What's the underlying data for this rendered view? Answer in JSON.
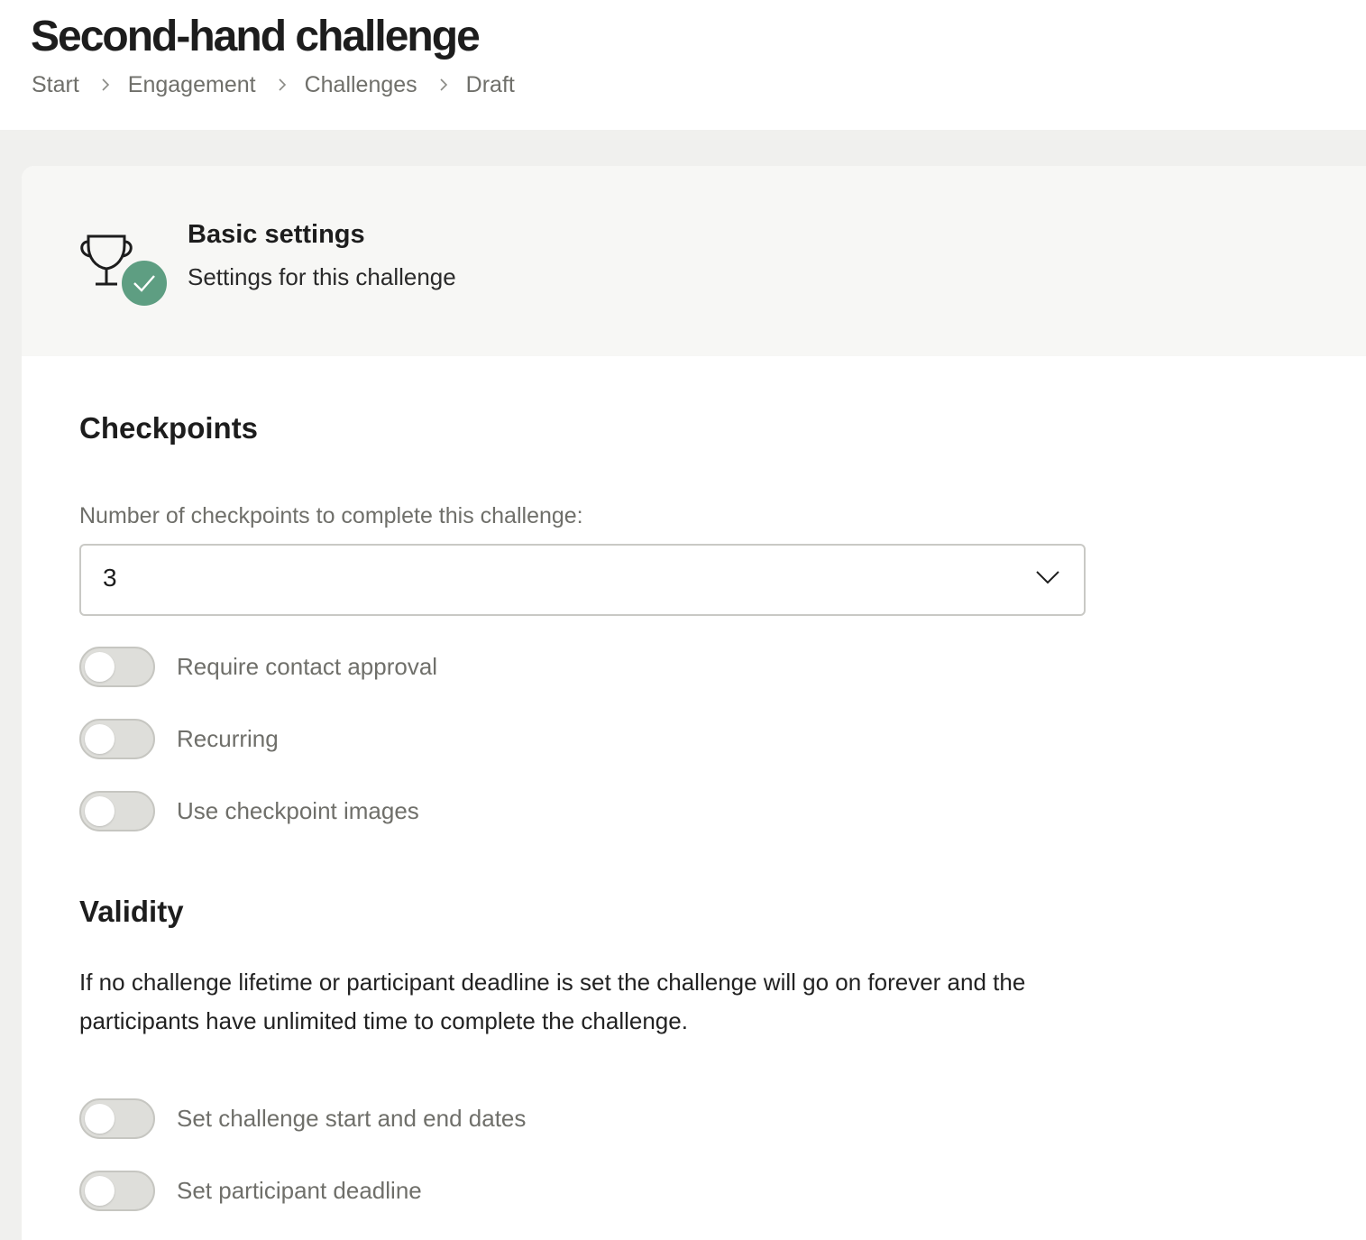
{
  "page": {
    "title": "Second-hand challenge",
    "breadcrumb": [
      "Start",
      "Engagement",
      "Challenges",
      "Draft"
    ]
  },
  "section": {
    "icon": "trophy-icon",
    "status_icon": "check-icon",
    "title": "Basic settings",
    "subtitle": "Settings for this challenge",
    "status_color": "#5e9e82"
  },
  "checkpoints": {
    "heading": "Checkpoints",
    "count_label": "Number of checkpoints to complete this challenge:",
    "count_value": "3",
    "toggles": [
      {
        "label": "Require contact approval",
        "on": false
      },
      {
        "label": "Recurring",
        "on": false
      },
      {
        "label": "Use checkpoint images",
        "on": false
      }
    ]
  },
  "validity": {
    "heading": "Validity",
    "description": "If no challenge lifetime or participant deadline is set the challenge will go on forever and the participants have unlimited time to complete the challenge.",
    "toggles": [
      {
        "label": "Set challenge start and end dates",
        "on": false
      },
      {
        "label": "Set participant deadline",
        "on": false
      }
    ]
  }
}
